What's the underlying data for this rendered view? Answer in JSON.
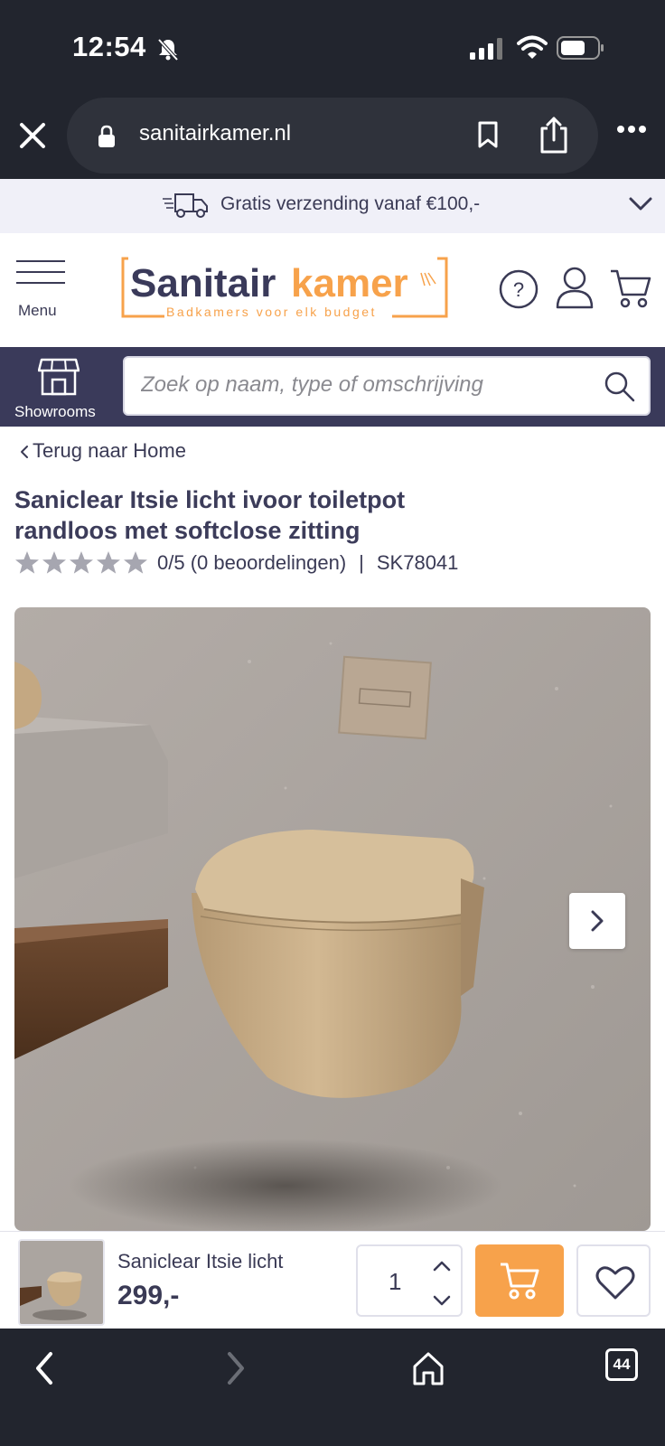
{
  "status": {
    "time": "12:54"
  },
  "browser": {
    "url": "sanitairkamer.nl"
  },
  "promo": {
    "text": "Gratis verzending vanaf €100,-"
  },
  "header": {
    "menu_label": "Menu",
    "logo_primary": "Sanitair",
    "logo_accent": "kamer",
    "logo_tagline": "Badkamers voor elk budget"
  },
  "search": {
    "showrooms_label": "Showrooms",
    "placeholder": "Zoek op naam, type of omschrijving"
  },
  "product": {
    "back_label": "Terug naar Home",
    "title": "Saniclear Itsie licht ivoor toiletpot randloos met softclose zitting",
    "rating": "0/5 (0 beoordelingen)",
    "rating_value": 0,
    "rating_max": 5,
    "separator": "|",
    "sku": "SK78041"
  },
  "sticky": {
    "name": "Saniclear Itsie licht",
    "price": "299,-",
    "quantity": "1"
  },
  "bottom_nav": {
    "tabs_count": "44"
  },
  "colors": {
    "dark_chrome": "#22252e",
    "brand_navy": "#3a3a5a",
    "brand_orange": "#f7a24b",
    "promo_bg": "#f0f0f8"
  }
}
